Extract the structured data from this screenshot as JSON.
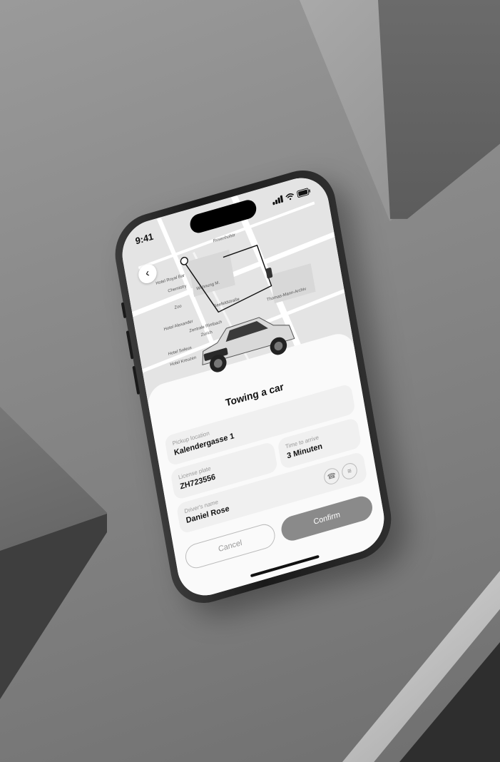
{
  "status_bar": {
    "time": "9:41"
  },
  "map": {
    "labels": [
      "Rosenhofstr",
      "Hotel Royal Bar",
      "Chemistry",
      "Wohnung M.",
      "Zoo",
      "Hotel Alexander",
      "Zentrale Rimbach",
      "Zurich",
      "Hotel Soleus",
      "Hotel Kreuzen",
      "Seefeldstraße",
      "Thomas-Mann-Archiv"
    ]
  },
  "sheet": {
    "title": "Towing a car",
    "pickup": {
      "label": "Pickup location",
      "value": "Kalendergasse 1"
    },
    "plate": {
      "label": "License plate",
      "value": "ZH723556"
    },
    "time": {
      "label": "Time to arrive",
      "value": "3 Minuten"
    },
    "driver": {
      "label": "Driver's name",
      "value": "Daniel Rose"
    },
    "cancel_label": "Cancel",
    "confirm_label": "Confirm"
  },
  "colors": {
    "confirm": "#8a8a8a",
    "card": "#f0f0f0",
    "background": "#8a8a8a"
  },
  "icons": [
    "back-arrow-icon",
    "phone-icon",
    "chat-icon",
    "signal-icon",
    "wifi-icon",
    "battery-icon"
  ]
}
